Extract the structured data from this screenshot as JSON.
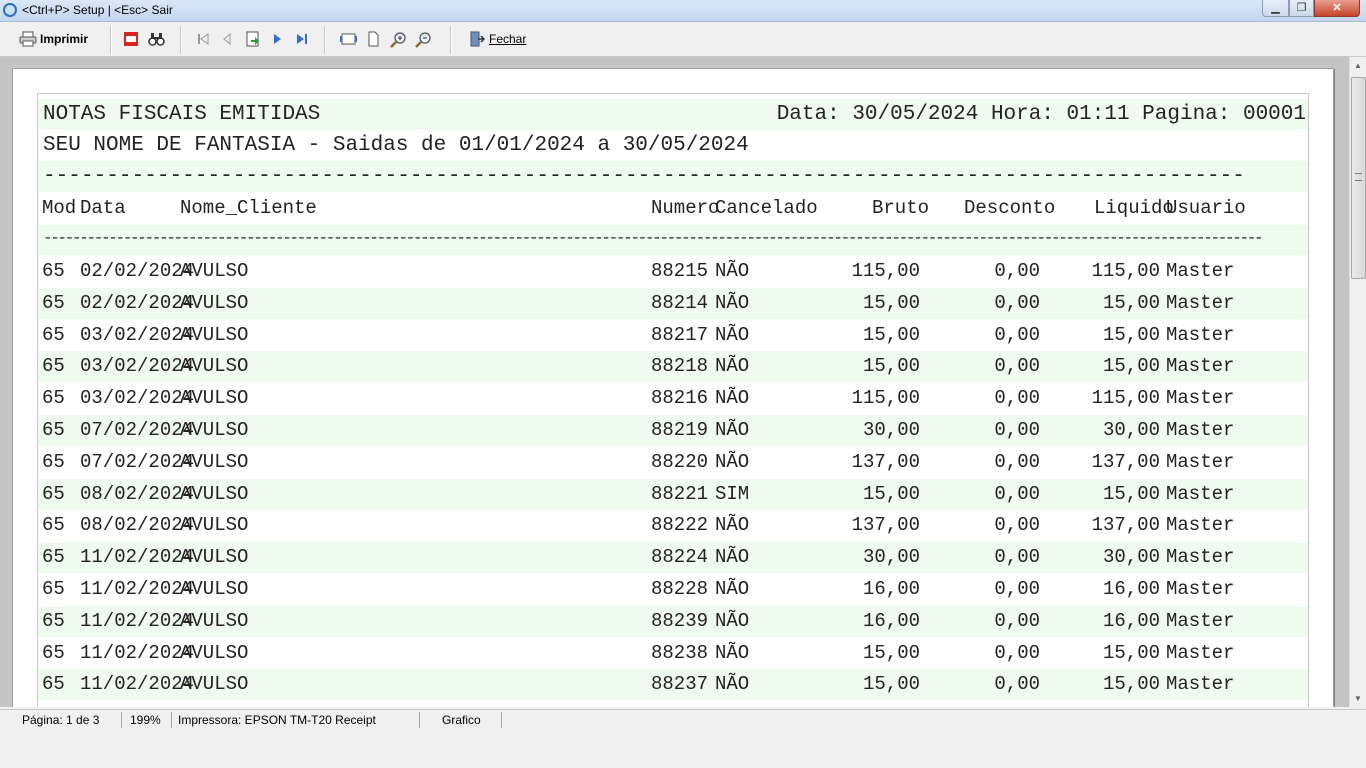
{
  "window": {
    "title": "<Ctrl+P> Setup | <Esc> Sair"
  },
  "toolbar": {
    "print_label": "Imprimir",
    "close_label": "Fechar"
  },
  "report": {
    "title": "NOTAS FISCAIS EMITIDAS",
    "date_info": "Data: 30/05/2024 Hora: 01:11 Pagina: 00001",
    "subtitle": "SEU NOME DE FANTASIA - Saidas de 01/01/2024 a 30/05/2024",
    "separator_long": "-----------------------------------------------------------------------------------------------",
    "separator_dashes": "------------------------------------------------------------------------------------------------------------------------------------------------------------------------",
    "columns": {
      "mod": "Mod",
      "data": "Data",
      "nome": "Nome_Cliente",
      "numero": "Numero",
      "cancelado": "Cancelado",
      "bruto": "Bruto",
      "desconto": "Desconto",
      "liquido": "Liquido",
      "usuario": "Usuario"
    },
    "rows": [
      {
        "mod": "65",
        "data": "02/02/2024",
        "nome": "AVULSO",
        "numero": "88215",
        "cancelado": "NÃO",
        "bruto": "115,00",
        "desconto": "0,00",
        "liquido": "115,00",
        "usuario": "Master"
      },
      {
        "mod": "65",
        "data": "02/02/2024",
        "nome": "AVULSO",
        "numero": "88214",
        "cancelado": "NÃO",
        "bruto": "15,00",
        "desconto": "0,00",
        "liquido": "15,00",
        "usuario": "Master"
      },
      {
        "mod": "65",
        "data": "03/02/2024",
        "nome": "AVULSO",
        "numero": "88217",
        "cancelado": "NÃO",
        "bruto": "15,00",
        "desconto": "0,00",
        "liquido": "15,00",
        "usuario": "Master"
      },
      {
        "mod": "65",
        "data": "03/02/2024",
        "nome": "AVULSO",
        "numero": "88218",
        "cancelado": "NÃO",
        "bruto": "15,00",
        "desconto": "0,00",
        "liquido": "15,00",
        "usuario": "Master"
      },
      {
        "mod": "65",
        "data": "03/02/2024",
        "nome": "AVULSO",
        "numero": "88216",
        "cancelado": "NÃO",
        "bruto": "115,00",
        "desconto": "0,00",
        "liquido": "115,00",
        "usuario": "Master"
      },
      {
        "mod": "65",
        "data": "07/02/2024",
        "nome": "AVULSO",
        "numero": "88219",
        "cancelado": "NÃO",
        "bruto": "30,00",
        "desconto": "0,00",
        "liquido": "30,00",
        "usuario": "Master"
      },
      {
        "mod": "65",
        "data": "07/02/2024",
        "nome": "AVULSO",
        "numero": "88220",
        "cancelado": "NÃO",
        "bruto": "137,00",
        "desconto": "0,00",
        "liquido": "137,00",
        "usuario": "Master"
      },
      {
        "mod": "65",
        "data": "08/02/2024",
        "nome": "AVULSO",
        "numero": "88221",
        "cancelado": "SIM",
        "bruto": "15,00",
        "desconto": "0,00",
        "liquido": "15,00",
        "usuario": "Master"
      },
      {
        "mod": "65",
        "data": "08/02/2024",
        "nome": "AVULSO",
        "numero": "88222",
        "cancelado": "NÃO",
        "bruto": "137,00",
        "desconto": "0,00",
        "liquido": "137,00",
        "usuario": "Master"
      },
      {
        "mod": "65",
        "data": "11/02/2024",
        "nome": "AVULSO",
        "numero": "88224",
        "cancelado": "NÃO",
        "bruto": "30,00",
        "desconto": "0,00",
        "liquido": "30,00",
        "usuario": "Master"
      },
      {
        "mod": "65",
        "data": "11/02/2024",
        "nome": "AVULSO",
        "numero": "88228",
        "cancelado": "NÃO",
        "bruto": "16,00",
        "desconto": "0,00",
        "liquido": "16,00",
        "usuario": "Master"
      },
      {
        "mod": "65",
        "data": "11/02/2024",
        "nome": "AVULSO",
        "numero": "88239",
        "cancelado": "NÃO",
        "bruto": "16,00",
        "desconto": "0,00",
        "liquido": "16,00",
        "usuario": "Master"
      },
      {
        "mod": "65",
        "data": "11/02/2024",
        "nome": "AVULSO",
        "numero": "88238",
        "cancelado": "NÃO",
        "bruto": "15,00",
        "desconto": "0,00",
        "liquido": "15,00",
        "usuario": "Master"
      },
      {
        "mod": "65",
        "data": "11/02/2024",
        "nome": "AVULSO",
        "numero": "88237",
        "cancelado": "NÃO",
        "bruto": "15,00",
        "desconto": "0,00",
        "liquido": "15,00",
        "usuario": "Master"
      }
    ]
  },
  "statusbar": {
    "page": "Página: 1 de 3",
    "zoom": "199%",
    "printer": "Impressora: EPSON TM-T20 Receipt",
    "mode": "Grafico"
  }
}
